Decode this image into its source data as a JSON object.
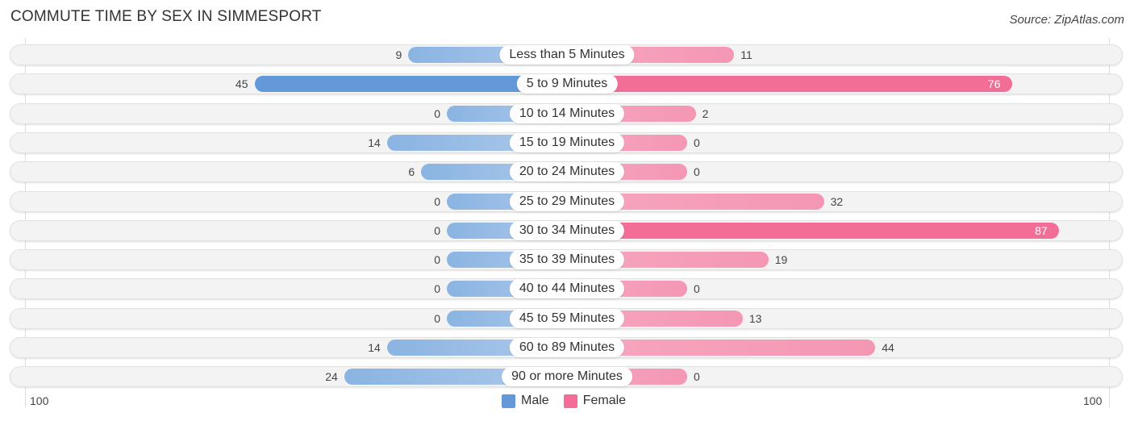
{
  "title": "COMMUTE TIME BY SEX IN SIMMESPORT",
  "source": "Source: ZipAtlas.com",
  "chart_data": {
    "type": "bar",
    "orientation": "horizontal-diverging",
    "title": "COMMUTE TIME BY SEX IN SIMMESPORT",
    "categories": [
      "Less than 5 Minutes",
      "5 to 9 Minutes",
      "10 to 14 Minutes",
      "15 to 19 Minutes",
      "20 to 24 Minutes",
      "25 to 29 Minutes",
      "30 to 34 Minutes",
      "35 to 39 Minutes",
      "40 to 44 Minutes",
      "45 to 59 Minutes",
      "60 to 89 Minutes",
      "90 or more Minutes"
    ],
    "series": [
      {
        "name": "Male",
        "color": "#6399d8",
        "values": [
          9,
          45,
          0,
          14,
          6,
          0,
          0,
          0,
          0,
          0,
          14,
          24
        ]
      },
      {
        "name": "Female",
        "color": "#f26e97",
        "values": [
          11,
          76,
          2,
          0,
          0,
          32,
          87,
          19,
          0,
          13,
          44,
          0
        ]
      }
    ],
    "axis_left_label": "100",
    "axis_right_label": "100",
    "xlim": [
      -100,
      100
    ],
    "legend": "bottom-center"
  },
  "legend": {
    "male": "Male",
    "female": "Female"
  }
}
